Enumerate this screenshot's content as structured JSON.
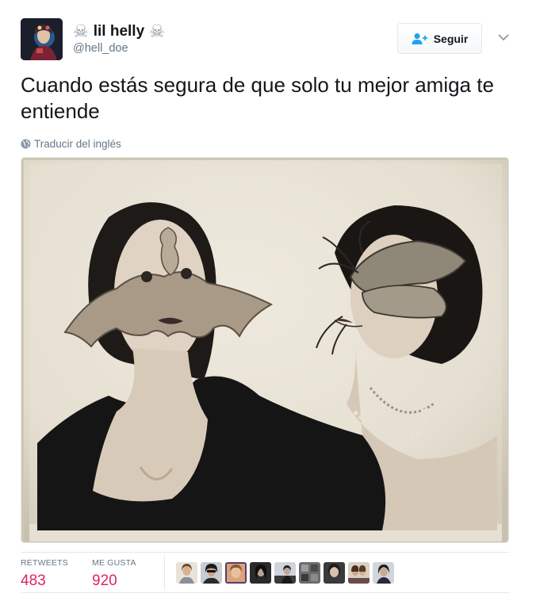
{
  "user": {
    "display_name": "lil helly",
    "name_emoji_left": "☠",
    "name_emoji_right": "☠",
    "handle": "@hell_doe",
    "avatar_icon": "profile-avatar"
  },
  "follow": {
    "label": "Seguir",
    "icon": "add-user-icon"
  },
  "menu": {
    "icon": "chevron-down-icon"
  },
  "tweet": {
    "text": "Cuando estás segura de que solo tu mejor amiga te entiende",
    "translate_label": "Traducir del inglés",
    "translate_icon": "globe-icon"
  },
  "media": {
    "description": "vintage photograph of two women wearing bat and insect masks"
  },
  "stats": {
    "retweets_label": "RETWEETS",
    "retweets_value": "483",
    "likes_label": "ME GUSTA",
    "likes_value": "920"
  },
  "likers_count": 9,
  "colors": {
    "text": "#14171a",
    "secondary": "#657786",
    "stat_value": "#e0245e",
    "follow_icon": "#1da1f2",
    "border": "#e1e8ed"
  }
}
